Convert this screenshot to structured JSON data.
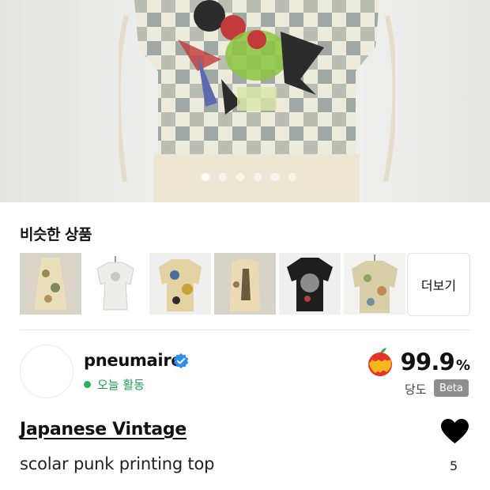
{
  "hero": {
    "image_icon": "product-photo",
    "carousel_total": 6,
    "carousel_active": 1
  },
  "similar": {
    "title": "비슷한 상품",
    "more_label": "더보기",
    "items": [
      {
        "icon": "dress-thumbnail"
      },
      {
        "icon": "white-top-thumbnail"
      },
      {
        "icon": "printed-shirt-thumbnail"
      },
      {
        "icon": "vest-thumbnail"
      },
      {
        "icon": "black-graphic-tee-thumbnail"
      },
      {
        "icon": "floral-top-thumbnail"
      }
    ]
  },
  "seller": {
    "name": "pneumaire",
    "activity": "오늘 활동",
    "activity_color": "#1f9d55",
    "score": "99.9",
    "score_unit": "%",
    "score_label": "당도",
    "beta": "Beta"
  },
  "product": {
    "brand": "Japanese Vintage",
    "title": "scolar punk printing top",
    "likes": "5"
  },
  "colors": {
    "accent_green": "#22b35e",
    "verified_blue": "#2f8cf0",
    "badge_gray": "#8e8e8e"
  }
}
